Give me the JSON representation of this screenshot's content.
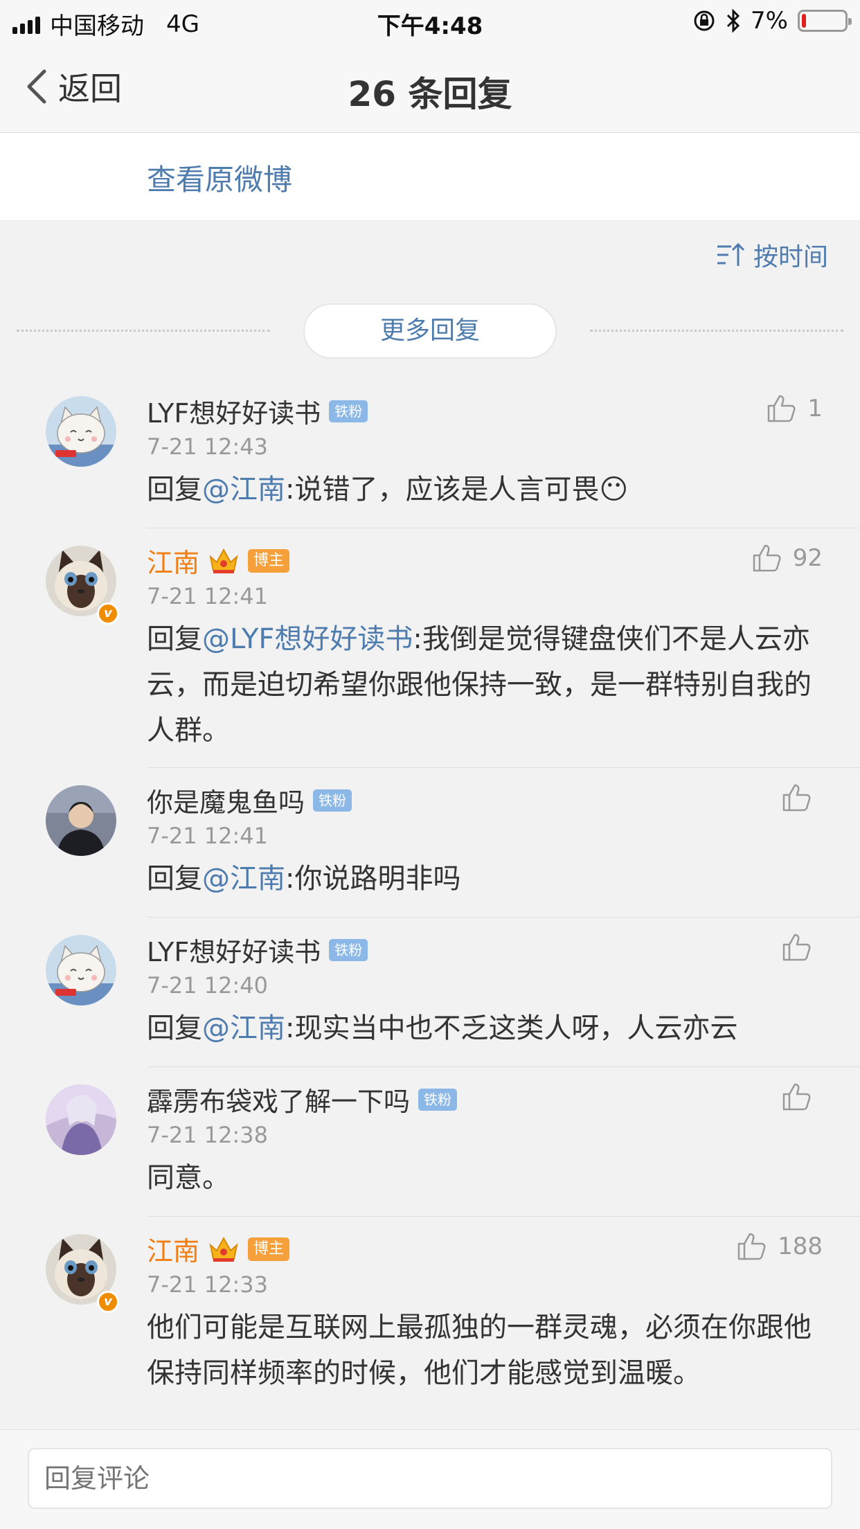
{
  "status_bar": {
    "carrier": "中国移动",
    "network": "4G",
    "time": "下午4:48",
    "battery_percent": "7%",
    "battery_level": 0.07
  },
  "nav": {
    "back_label": "返回",
    "title": "26 条回复"
  },
  "view_original": "查看原微博",
  "sort_label": "按时间",
  "more_replies": "更多回复",
  "colors": {
    "link": "#4f7cae",
    "author": "#f07e12",
    "fan_tag": "#8cb8e8",
    "host_tag": "#f5a03a"
  },
  "comments": [
    {
      "user": "LYF想好好读书",
      "tag": "铁粉",
      "time": "7-21 12:43",
      "likes": "1",
      "reply_prefix": "回复",
      "mention": "@江南",
      "text": ":说错了，应该是人言可畏😶",
      "avatar_icon": "cat-cartoon-avatar"
    },
    {
      "user": "江南",
      "tag": "博主",
      "time": "7-21 12:41",
      "likes": "92",
      "reply_prefix": "回复",
      "mention": "@LYF想好好读书",
      "text": ":我倒是觉得键盘侠们不是人云亦云，而是迫切希望你跟他保持一致，是一群特别自我的人群。",
      "avatar_icon": "siamese-cat-avatar"
    },
    {
      "user": "你是魔鬼鱼吗",
      "tag": "铁粉",
      "time": "7-21 12:41",
      "likes": "",
      "reply_prefix": "回复",
      "mention": "@江南",
      "text": ":你说路明非吗",
      "avatar_icon": "person-photo-avatar"
    },
    {
      "user": "LYF想好好读书",
      "tag": "铁粉",
      "time": "7-21 12:40",
      "likes": "",
      "reply_prefix": "回复",
      "mention": "@江南",
      "text": ":现实当中也不乏这类人呀，人云亦云",
      "avatar_icon": "cat-cartoon-avatar"
    },
    {
      "user": "霹雳布袋戏了解一下吗",
      "tag": "铁粉",
      "time": "7-21 12:38",
      "likes": "",
      "reply_prefix": "",
      "mention": "",
      "text": "同意。",
      "avatar_icon": "puppet-character-avatar"
    },
    {
      "user": "江南",
      "tag": "博主",
      "time": "7-21 12:33",
      "likes": "188",
      "reply_prefix": "",
      "mention": "",
      "text": "他们可能是互联网上最孤独的一群灵魂，必须在你跟他保持同样频率的时候，他们才能感觉到温暖。",
      "avatar_icon": "siamese-cat-avatar"
    }
  ],
  "reply_placeholder": "回复评论"
}
